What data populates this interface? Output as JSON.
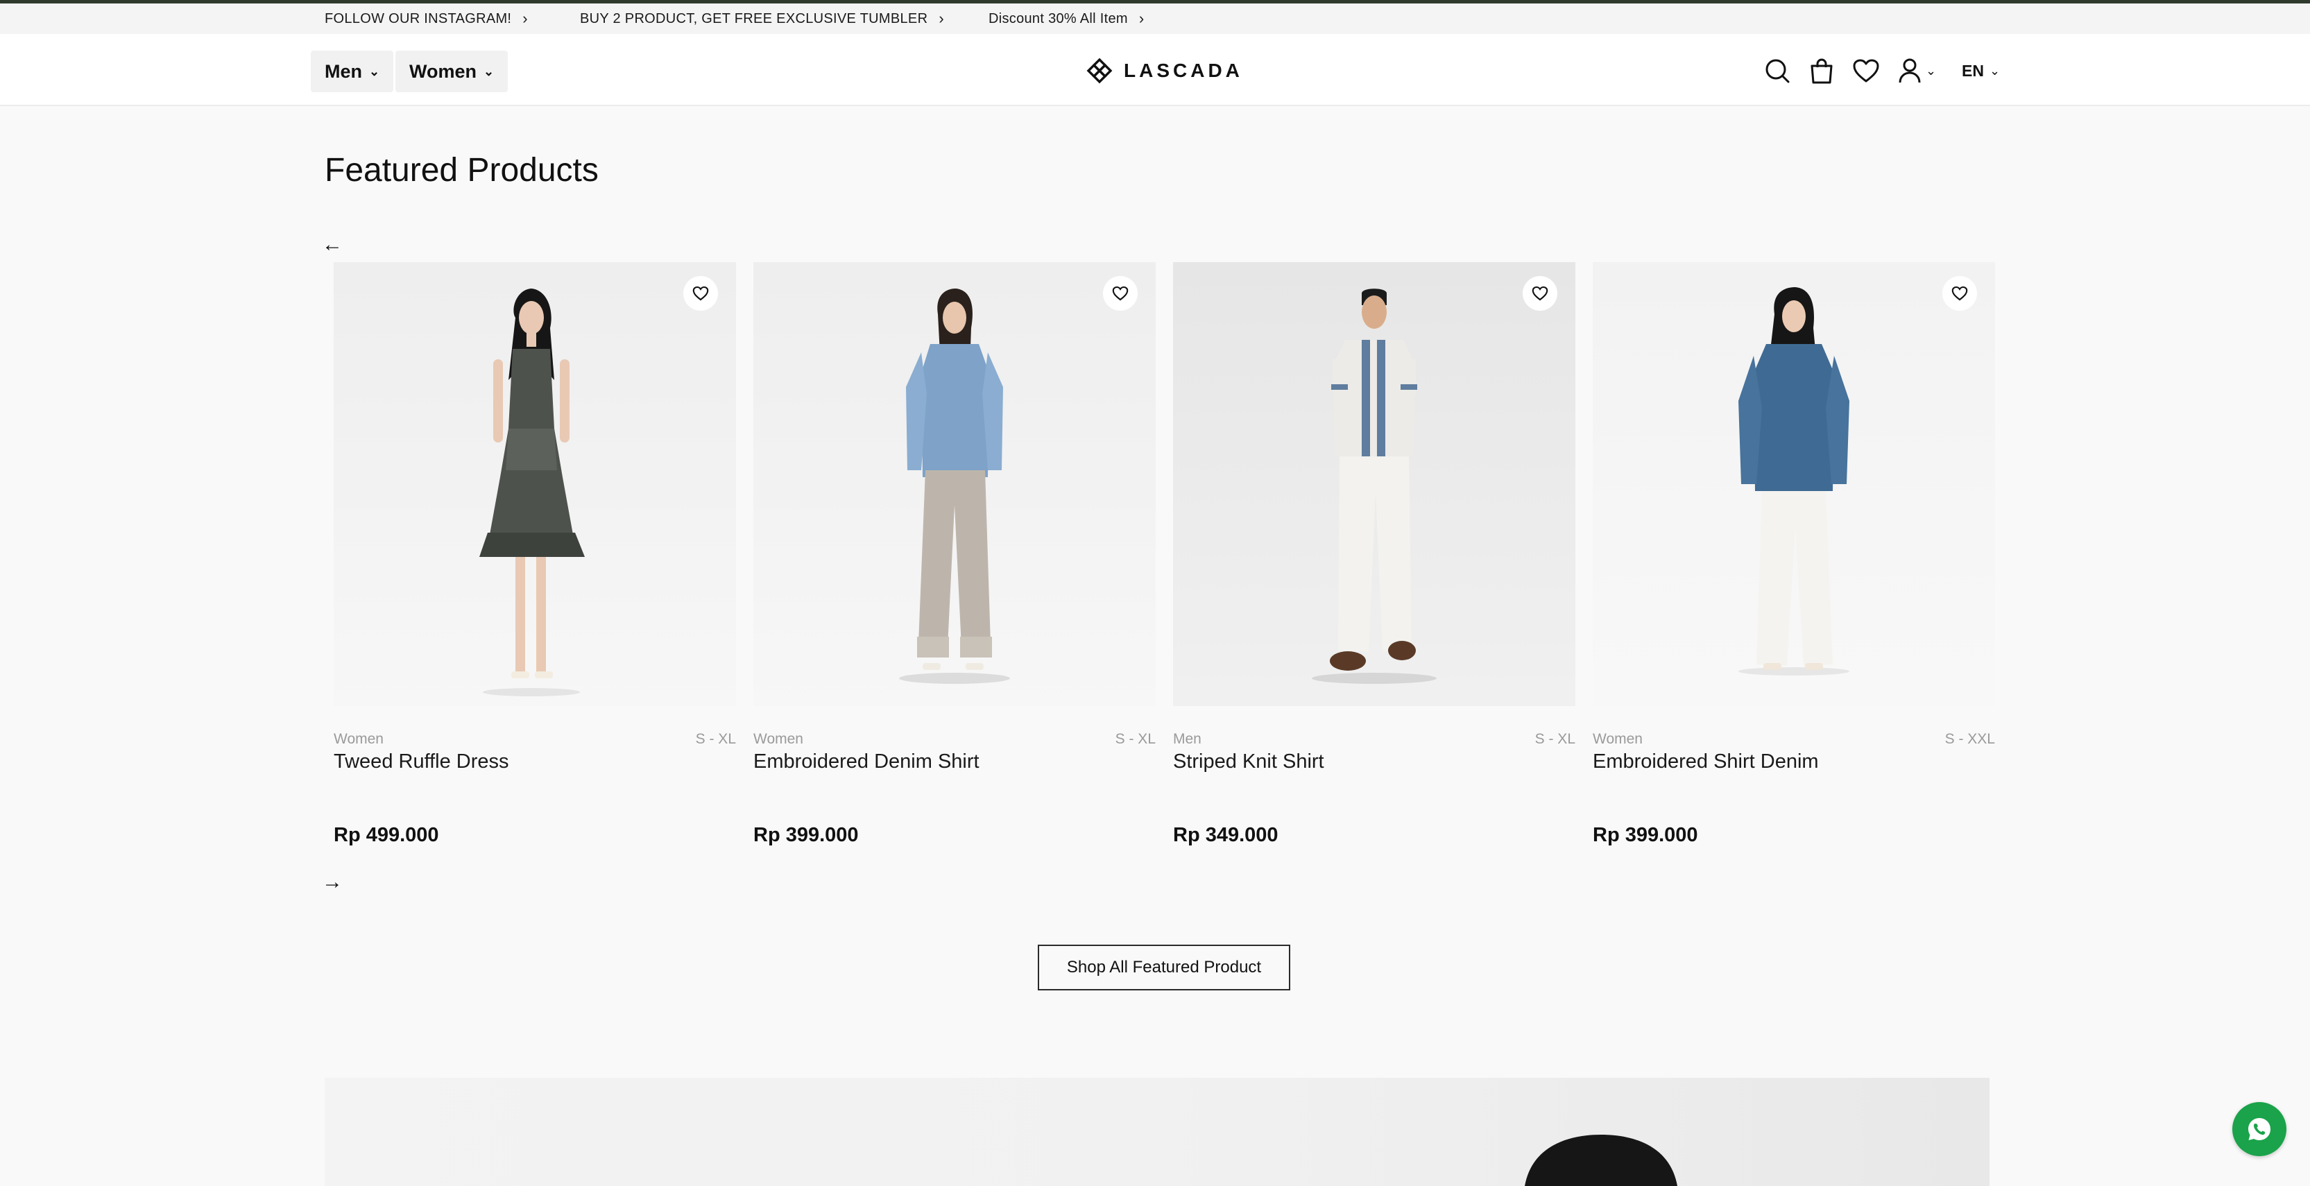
{
  "announcements": [
    {
      "text": "FOLLOW OUR INSTAGRAM!"
    },
    {
      "text": "BUY 2 PRODUCT, GET FREE EXCLUSIVE TUMBLER"
    },
    {
      "text": "Discount 30% All Item"
    }
  ],
  "nav": {
    "men_label": "Men",
    "women_label": "Women"
  },
  "brand": {
    "name": "LASCADA",
    "accent": "#2f3a2c"
  },
  "header_icons": [
    "search-icon",
    "shopping-bag-icon",
    "heart-icon",
    "user-icon"
  ],
  "language": {
    "selected": "EN"
  },
  "section": {
    "title": "Featured Products"
  },
  "products": [
    {
      "category": "Women",
      "sizes": "S - XL",
      "name": "Tweed Ruffle Dress",
      "price": "Rp 499.000"
    },
    {
      "category": "Women",
      "sizes": "S - XL",
      "name": "Embroidered Denim Shirt",
      "price": "Rp 399.000"
    },
    {
      "category": "Men",
      "sizes": "S - XL",
      "name": "Striped Knit Shirt",
      "price": "Rp 349.000"
    },
    {
      "category": "Women",
      "sizes": "S - XXL",
      "name": "Embroidered Shirt Denim",
      "price": "Rp 399.000"
    }
  ],
  "shop_all_label": "Shop All Featured Product",
  "whatsapp": {
    "color": "#1aa34a",
    "icon": "whatsapp-icon"
  }
}
